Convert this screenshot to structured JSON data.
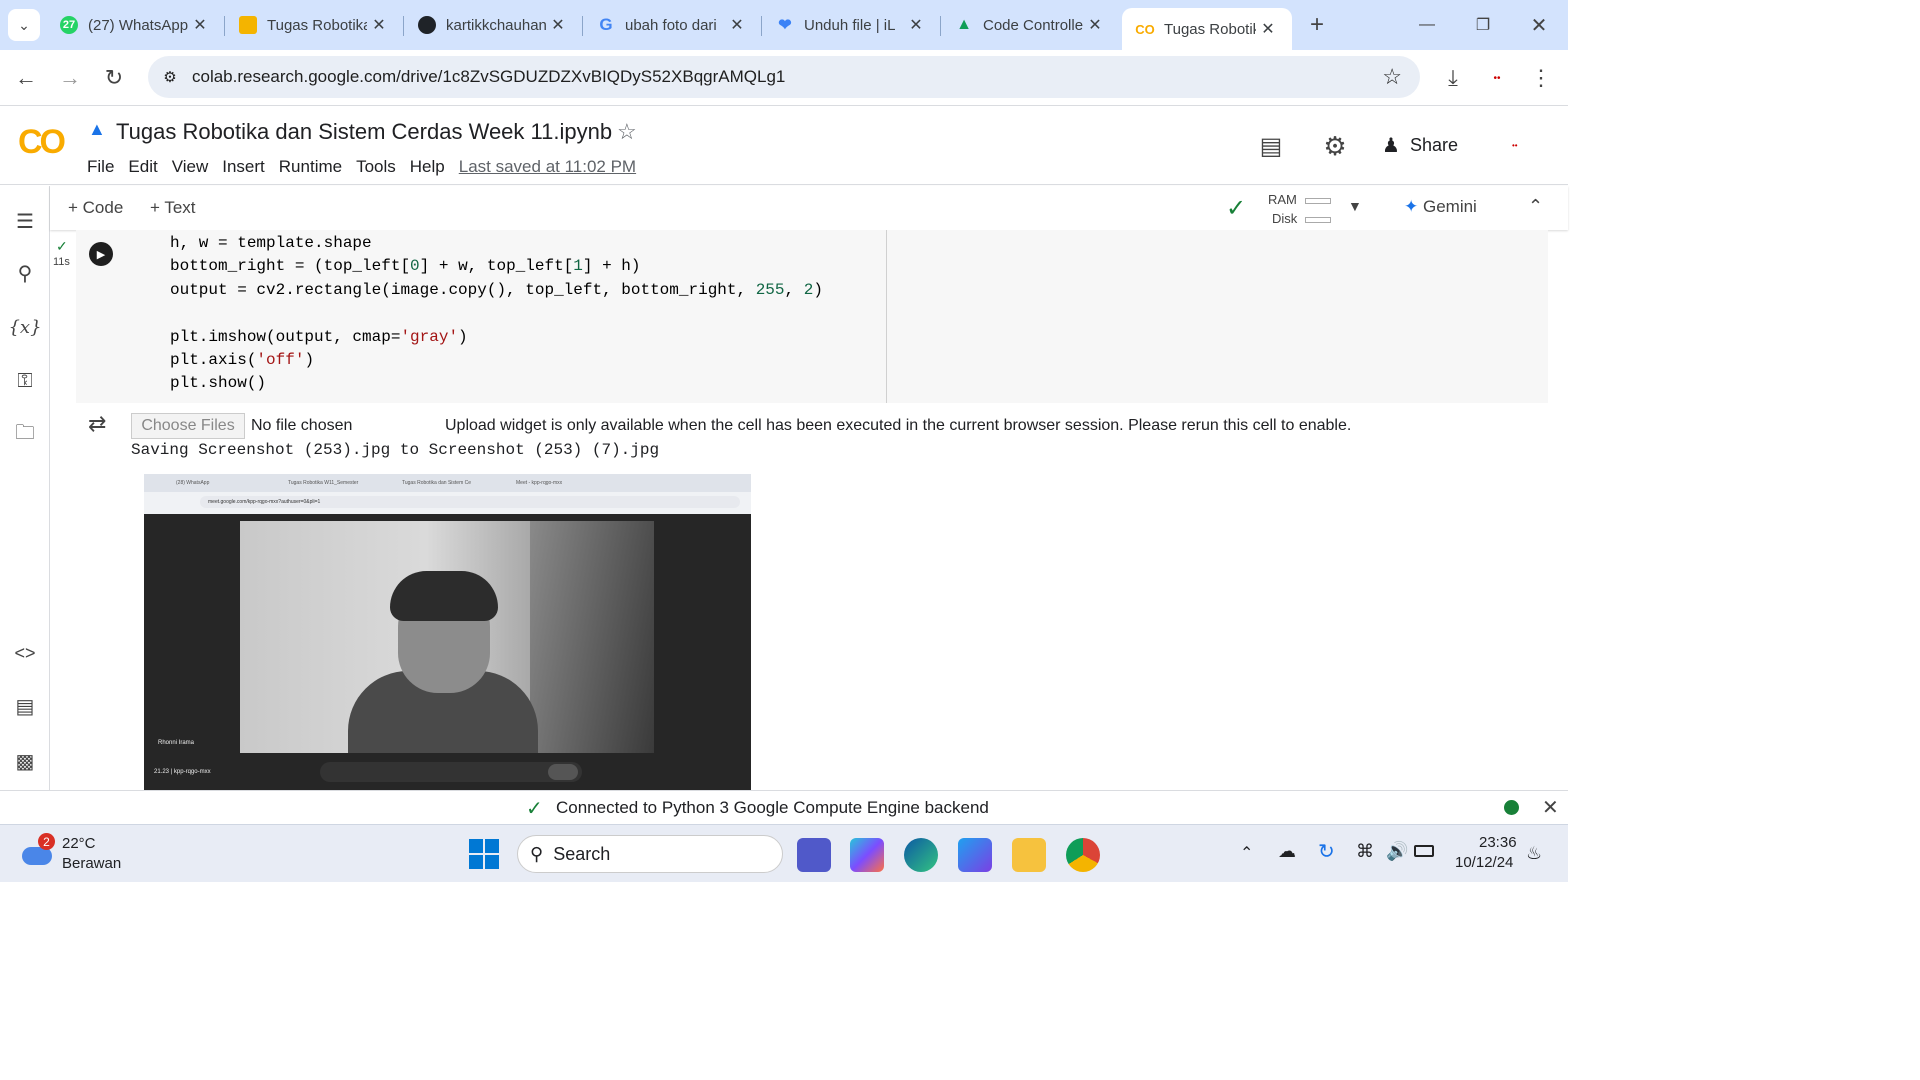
{
  "browser": {
    "tabs": [
      {
        "title": "(27) WhatsApp",
        "badge": "27",
        "icon": "whatsapp-icon"
      },
      {
        "title": "Tugas Robotika",
        "icon": "slides-icon"
      },
      {
        "title": "kartikkchauhan",
        "icon": "github-icon"
      },
      {
        "title": "ubah foto dari",
        "icon": "google-icon"
      },
      {
        "title": "Unduh file | iL",
        "icon": "ilovepdf-icon"
      },
      {
        "title": "Code Controller",
        "icon": "drive-icon"
      },
      {
        "title": "Tugas Robotika",
        "icon": "colab-icon"
      }
    ],
    "url": "colab.research.google.com/drive/1c8ZvSGDUZDZXvBIQDyS52XBqgrAMQLg1",
    "new_tab": "+"
  },
  "colab": {
    "logo": "CO",
    "notebook_title": "Tugas Robotika dan Sistem Cerdas Week 11.ipynb",
    "menu": [
      "File",
      "Edit",
      "View",
      "Insert",
      "Runtime",
      "Tools",
      "Help"
    ],
    "last_saved": "Last saved at 11:02 PM",
    "share": "Share",
    "add_code": "+ Code",
    "add_text": "+ Text",
    "ram": "RAM",
    "disk": "Disk",
    "gemini": "Gemini"
  },
  "cell": {
    "exec_time": "11s",
    "code_lines": [
      "h, w = template.shape",
      "bottom_right = (top_left[0] + w, top_left[1] + h)",
      "output = cv2.rectangle(image.copy(), top_left, bottom_right, 255, 2)",
      "",
      "plt.imshow(output, cmap='gray')",
      "plt.axis('off')",
      "plt.show()"
    ]
  },
  "output": {
    "choose_files": "Choose Files",
    "no_file": "No file chosen",
    "upload_msg": "Upload widget is only available when the cell has been executed in the current browser session. Please rerun this cell to enable.",
    "saving": "Saving Screenshot (253).jpg to Screenshot (253) (7).jpg",
    "inner_screenshot": {
      "tabs": [
        "(28) WhatsApp",
        "Tugas Robotika W11_Semester",
        "Tugas Robotika dan Sistem Ce",
        "Meet - kpp-rqgo-mxx"
      ],
      "url": "meet.google.com/kpp-rqgo-mxx?authuser=0&pli=1",
      "participant": "Rhonni Irama",
      "meeting": "21.23 | kpp-rqgo-mxx"
    }
  },
  "statusbar": {
    "text": "Connected to Python 3 Google Compute Engine backend"
  },
  "taskbar": {
    "weather_badge": "2",
    "temp": "22°C",
    "condition": "Berawan",
    "search": "Search",
    "time": "23:36",
    "date": "10/12/24"
  }
}
